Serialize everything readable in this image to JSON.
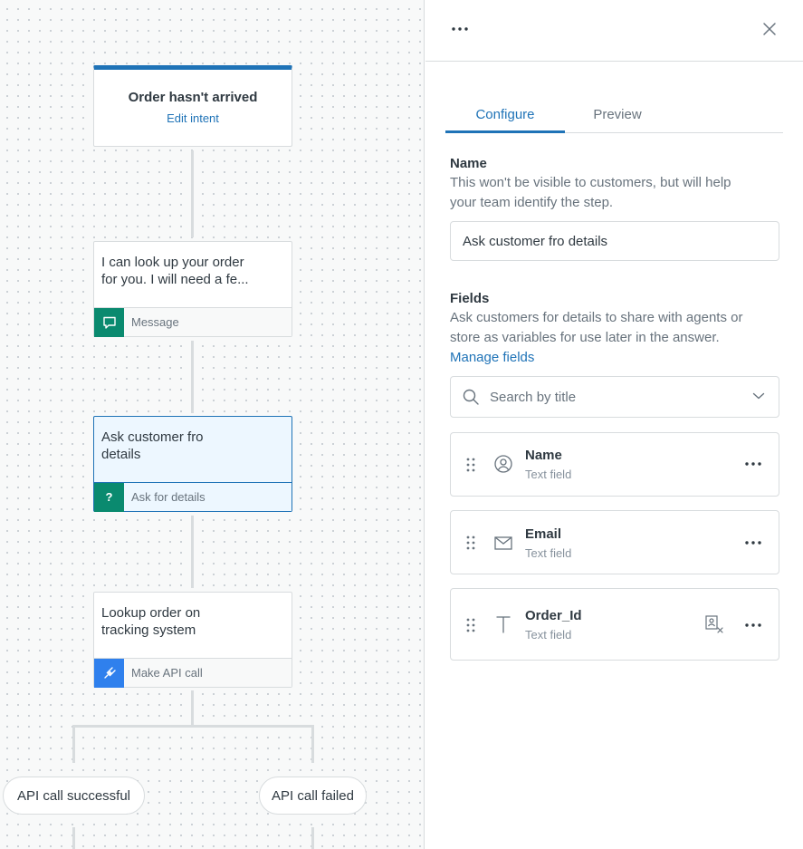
{
  "canvas": {
    "start_node": {
      "title": "Order hasn't arrived",
      "link": "Edit intent"
    },
    "nodes": [
      {
        "line1": "I can look up your order",
        "line2": "for you. I will need a fe...",
        "type_label": "Message",
        "icon": "chat-bubble-icon"
      },
      {
        "line1": "Ask customer fro",
        "line2": "details",
        "type_label": "Ask for details",
        "icon": "question-mark-icon"
      },
      {
        "line1": "Lookup order on",
        "line2": "tracking system",
        "type_label": "Make API call",
        "icon": "plug-icon"
      }
    ],
    "branches": {
      "success": "API call successful",
      "failed": "API call failed"
    }
  },
  "panel": {
    "tabs": [
      "Configure",
      "Preview"
    ],
    "name_section": {
      "label": "Name",
      "hint_line1": "This won't be visible to customers, but will help",
      "hint_line2": "your team identify the step.",
      "value": "Ask customer fro details"
    },
    "fields_section": {
      "label": "Fields",
      "hint_line1": "Ask customers for details to share with agents or",
      "hint_line2": "store as variables for use later in the answer.",
      "manage_link": "Manage fields",
      "search_placeholder": "Search by title",
      "items": [
        {
          "name": "Name",
          "type": "Text field",
          "icon": "user-circle-icon"
        },
        {
          "name": "Email",
          "type": "Text field",
          "icon": "envelope-icon"
        },
        {
          "name": "Order_Id",
          "type": "Text field",
          "icon": "text-t-icon",
          "extra_icon": "id-card-remove-icon"
        }
      ]
    }
  },
  "colors": {
    "accent": "#1f73b7",
    "teal": "#0a8a6f",
    "api_blue": "#2f80ed",
    "border": "#d8dcde"
  }
}
